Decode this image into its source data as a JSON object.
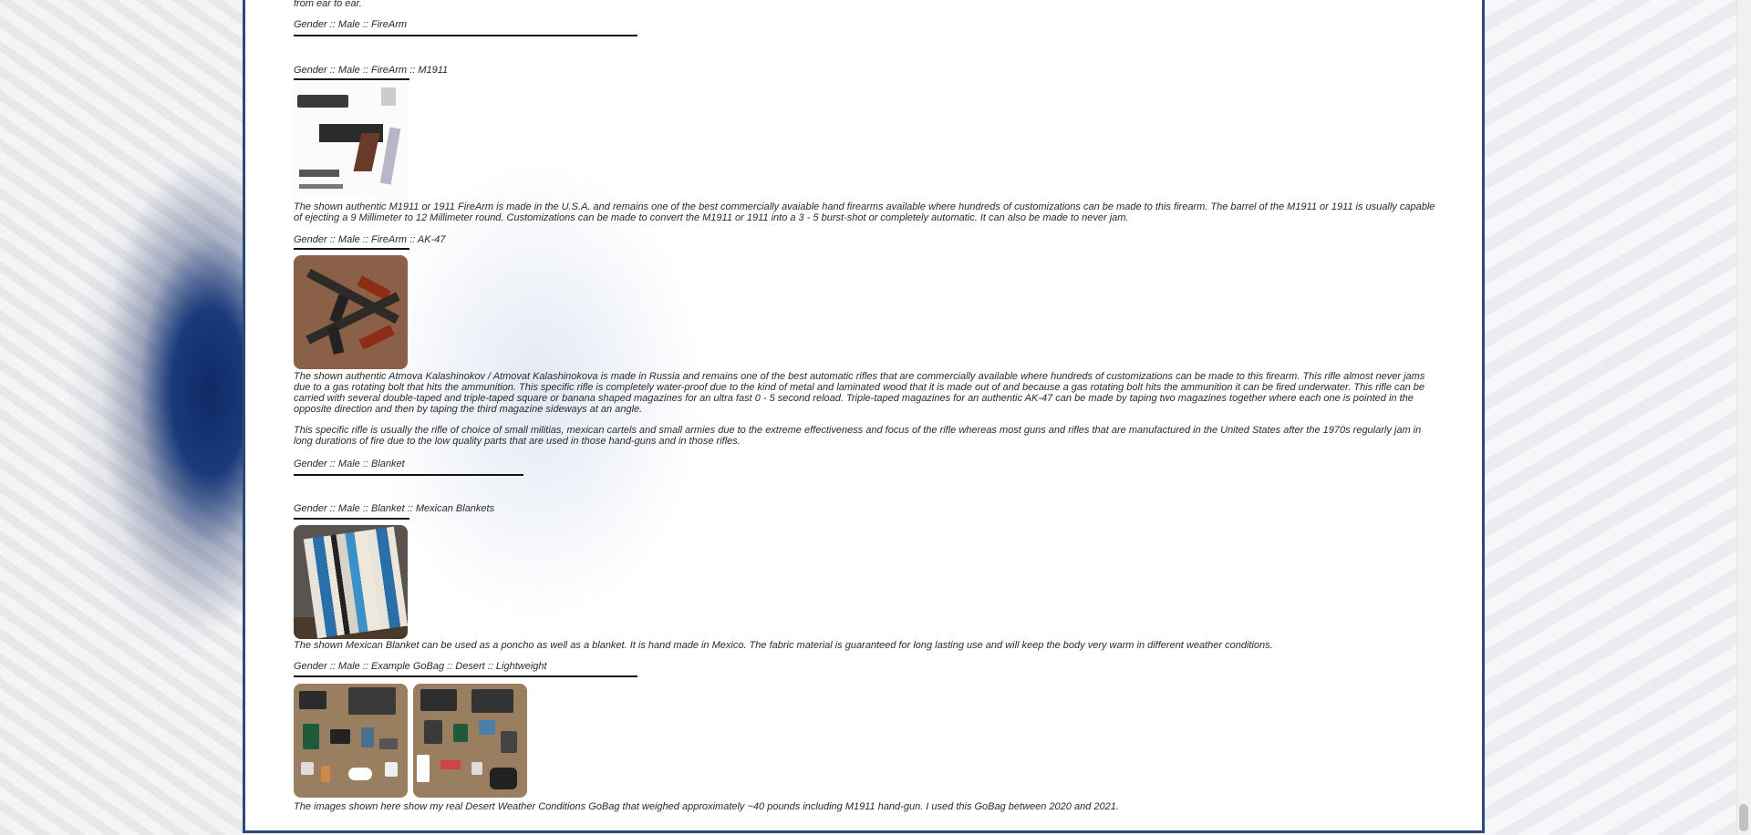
{
  "top_fragment": "from ear to ear.",
  "sections": [
    {
      "heading": "Gender :: Male :: FireArm"
    },
    {
      "heading": "Gender :: Male :: FireArm :: M1911",
      "description": "The shown authentic M1911 or 1911 FireArm is made in the U.S.A. and remains one of the best commercially avaiable hand firearms available where hundreds of customizations can be made to this firearm. The barrel of the M1911 or 1911 is usually capable of ejecting a 9 Millimeter to 12 Millimeter round. Customizations can be made to convert the M1911 or 1911 into a 3 - 5 burst-shot or completely automatic. It can also be made to never jam."
    },
    {
      "heading": "Gender :: Male :: FireArm :: AK-47",
      "description": "The shown authentic Atmova Kalashinokov / Atmovat Kalashinokova is made in Russia and remains one of the best automatic rifles that are commercially available where hundreds of customizations can be made to this firearm. This rifle almost never jams due to a gas rotating bolt that hits the ammunition. This specific rifle is completely water-proof due to the kind of metal and laminated wood that it is made out of and because a gas rotating bolt hits the ammunition it can be fired underwater. This rifle can be carried with several double-taped and triple-taped square or banana shaped magazines for an ultra fast 0 - 5 second reload. Triple-taped magazines for an authentic AK-47 can be made by taping two magazines together where each one is pointed in the opposite direction and then by taping the third magazine sideways at an angle.",
      "description2": "This specific rifle is usually the rifle of choice of small militias, mexican cartels and small armies due to the extreme effectiveness and focus of the rifle whereas most guns and rifles that are manufactured in the United States after the 1970s regularly jam in long durations of fire due to the low quality parts that are used in those hand-guns and in those rifles."
    },
    {
      "heading": "Gender :: Male :: Blanket"
    },
    {
      "heading": "Gender :: Male :: Blanket :: Mexican Blankets",
      "description": "The shown Mexican Blanket can be used as a poncho as well as a blanket. It is hand made in Mexico. The fabric material is guaranteed for long lasting use and will keep the body very warm in different weather conditions."
    },
    {
      "heading": "Gender :: Male :: Example GoBag :: Desert :: Lightweight",
      "description": "The images shown here show my real Desert Weather Conditions GoBag that weighed approximately ~40 pounds including M1911 hand-gun. I used this GoBag between 2020 and 2021."
    }
  ]
}
